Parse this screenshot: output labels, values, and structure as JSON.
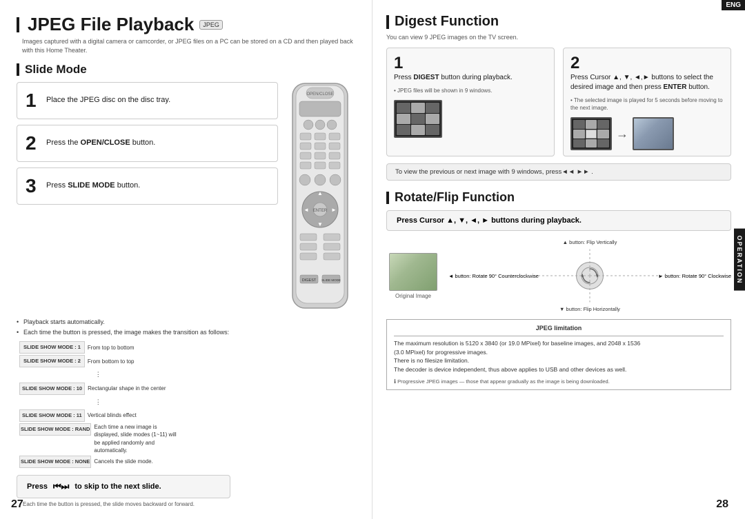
{
  "left": {
    "title": "JPEG File Playback",
    "title_badge": "JPEG",
    "subtitle": "Images captured with a digital camera or camcorder, or JPEG files on a PC can be stored on a CD and then\nplayed back with this Home Theater.",
    "slide_mode_title": "Slide Mode",
    "steps": [
      {
        "number": "1",
        "text": "Place the JPEG disc on the disc tray."
      },
      {
        "number": "2",
        "text_plain": "Press the ",
        "text_bold": "OPEN/CLOSE",
        "text_end": " button."
      },
      {
        "number": "3",
        "text_plain": "Press ",
        "text_bold": "SLIDE MODE",
        "text_end": " button."
      }
    ],
    "bullet_notes": [
      "Playback starts automatically.",
      "Each time the button is pressed, the image makes the transition as follows:"
    ],
    "modes": [
      {
        "label": "SLIDE SHOW MODE : 1",
        "desc": "From top to bottom"
      },
      {
        "label": "SLIDE SHOW MODE : 2",
        "desc": "From bottom to top"
      },
      {
        "label": "SLIDE SHOW MODE : 10",
        "desc": "Rectangular shape in the center"
      },
      {
        "label": "SLIDE SHOW MODE : 11",
        "desc": "Vertical blinds effect"
      },
      {
        "label": "SLIDE SHOW MODE : RAND",
        "desc": "Each time a new image is displayed, slide modes (1~11) will be applied randomly and automatically."
      },
      {
        "label": "SLIDE SHOW MODE : NONE",
        "desc": "Cancels the slide mode."
      }
    ],
    "skip_text_pre": "Press",
    "skip_icon": "⏮ ⏭",
    "skip_text_post": "to skip to the next slide.",
    "skip_note": "• Each time the button is pressed, the slide moves backward or forward.",
    "page_number": "27"
  },
  "right": {
    "eng_badge": "ENG",
    "operation_badge": "OPERATION",
    "digest_title": "Digest Function",
    "digest_intro": "You can view 9 JPEG images on the TV screen.",
    "digest_step1_num": "1",
    "digest_step1_text_pre": "Press ",
    "digest_step1_text_bold": "DIGEST",
    "digest_step1_text_end": " button during playback.",
    "digest_step1_note": "• JPEG files will be shown in 9 windows.",
    "digest_step2_num": "2",
    "digest_step2_text_pre": "Press Cursor ▲, ▼, ◄,► buttons to select the desired image and then press ",
    "digest_step2_text_bold": "ENTER",
    "digest_step2_text_end": " button.",
    "digest_step2_note": "• The selected image is played for 5 seconds before moving to the next image.",
    "nav_hint": "To view the previous or next image with 9 windows, press◄◄ ►► .",
    "rotate_title": "Rotate/Flip Function",
    "rotate_box_text": "Press Cursor ▲, ▼, ◄, ► buttons during playback.",
    "rotate_labels": {
      "top": "▲ button: Flip Vertically",
      "bottom": "▼ button: Flip Horizontally",
      "right": "► button: Rotate 90° Clockwise",
      "left": "◄ button: Rotate 90° Counterclockwise"
    },
    "original_label": "Original Image",
    "jpeg_limit_title": "JPEG limitation",
    "jpeg_limit_lines": [
      "The maximum resolution is 5120 x 3840 (or 19.0 MPixel) for baseline images, and 2048 x 1536",
      "(3.0 MPixel) for progressive images.",
      "There is no filesize limitation.",
      "The decoder is device independent, thus above applies to USB and other devices as well."
    ],
    "jpeg_limit_note": "Progressive JPEG images — those that appear gradually as the image is being downloaded.",
    "page_number": "28"
  }
}
